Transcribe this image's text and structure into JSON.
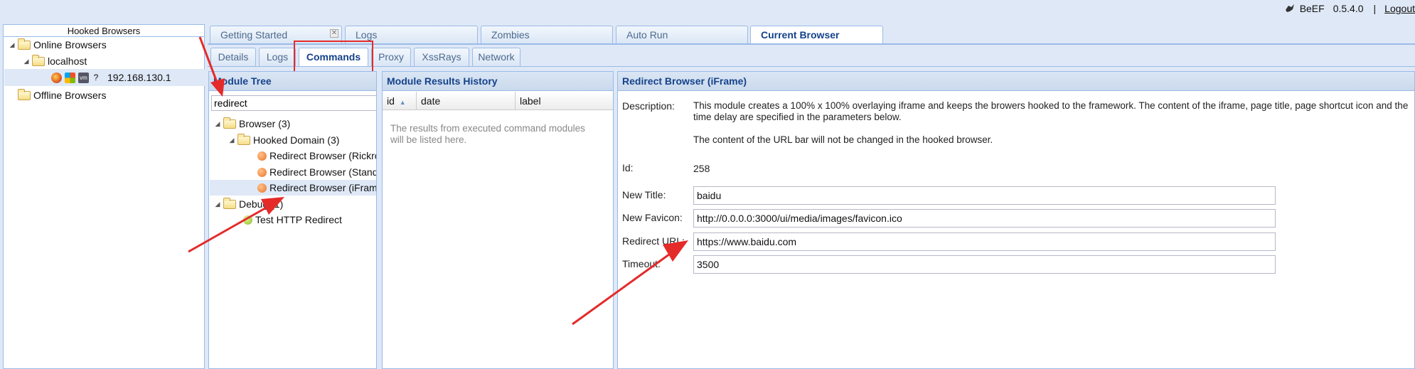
{
  "header": {
    "app_name": "BeEF",
    "version": "0.5.4.0",
    "separator": "|",
    "logout_label": "Logout"
  },
  "left_panel": {
    "title": "Hooked Browsers",
    "online_label": "Online Browsers",
    "localhost_label": "localhost",
    "host_ip": "192.168.130.1",
    "offline_label": "Offline Browsers"
  },
  "main_tabs": [
    {
      "label": "Getting Started"
    },
    {
      "label": "Logs"
    },
    {
      "label": "Zombies"
    },
    {
      "label": "Auto Run"
    },
    {
      "label": "Current Browser"
    }
  ],
  "sub_tabs": [
    {
      "label": "Details"
    },
    {
      "label": "Logs"
    },
    {
      "label": "Commands"
    },
    {
      "label": "Proxy"
    },
    {
      "label": "XssRays"
    },
    {
      "label": "Network"
    }
  ],
  "module_tree": {
    "title": "Module Tree",
    "search_value": "redirect",
    "browser_folder": "Browser (3)",
    "hooked_domain_folder": "Hooked Domain (3)",
    "modules": [
      "Redirect Browser (Rickroll)",
      "Redirect Browser (Standard)",
      "Redirect Browser (iFrame)"
    ],
    "debug_folder": "Debug (1)",
    "debug_module": "Test HTTP Redirect"
  },
  "results": {
    "title": "Module Results History",
    "columns": [
      "id",
      "date",
      "label"
    ],
    "empty_text": "The results from executed command modules will be listed here."
  },
  "detail": {
    "title": "Redirect Browser (iFrame)",
    "description_label": "Description:",
    "description_p1": "This module creates a 100% x 100% overlaying iframe and keeps the browers hooked to the framework. The content of the iframe, page title, page shortcut icon and the time delay are specified in the parameters below.",
    "description_p2": "The content of the URL bar will not be changed in the hooked browser.",
    "id_label": "Id:",
    "id_value": "258",
    "new_title_label": "New Title:",
    "new_title_value": "baidu",
    "new_favicon_label": "New Favicon:",
    "new_favicon_value": "http://0.0.0.0:3000/ui/media/images/favicon.ico",
    "redirect_url_label": "Redirect URL:",
    "redirect_url_value": "https://www.baidu.com",
    "timeout_label": "Timeout:",
    "timeout_value": "3500"
  },
  "colors": {
    "accent": "#15428b",
    "border": "#99bbe8",
    "annotation": "#e52a2a",
    "background": "#dfe8f6"
  }
}
